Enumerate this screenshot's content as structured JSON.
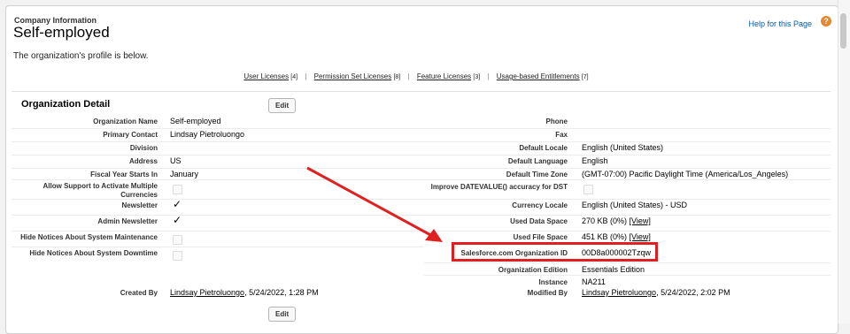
{
  "header": {
    "section_label": "Company Information",
    "title": "Self-employed",
    "help_link": "Help for this Page",
    "help_icon": "?",
    "description": "The organization's profile is below."
  },
  "links": [
    {
      "label": "User Licenses",
      "count": "[4]"
    },
    {
      "label": "Permission Set Licenses",
      "count": "[8]"
    },
    {
      "label": "Feature Licenses",
      "count": "[3]"
    },
    {
      "label": "Usage-based Entitlements",
      "count": "[7]"
    }
  ],
  "link_separator": "|",
  "detail": {
    "heading": "Organization Detail",
    "edit_label": "Edit",
    "left": {
      "org_name_label": "Organization Name",
      "org_name": "Self-employed",
      "primary_contact_label": "Primary Contact",
      "primary_contact": "Lindsay Pietroluongo",
      "division_label": "Division",
      "address_label": "Address",
      "address": "US",
      "fiscal_label": "Fiscal Year Starts In",
      "fiscal": "January",
      "allow_support_label": "Allow Support to Activate Multiple Currencies",
      "newsletter_label": "Newsletter",
      "admin_newsletter_label": "Admin Newsletter",
      "hide_maintenance_label": "Hide Notices About System Maintenance",
      "hide_downtime_label": "Hide Notices About System Downtime",
      "created_by_label": "Created By",
      "created_by_user": "Lindsay Pietroluongo",
      "created_by_date": ", 5/24/2022, 1:28 PM"
    },
    "right": {
      "phone_label": "Phone",
      "fax_label": "Fax",
      "locale_label": "Default Locale",
      "locale": "English (United States)",
      "language_label": "Default Language",
      "language": "English",
      "timezone_label": "Default Time Zone",
      "timezone": "(GMT-07:00) Pacific Daylight Time (America/Los_Angeles)",
      "datevalue_label": "Improve DATEVALUE() accuracy for DST",
      "currency_label": "Currency Locale",
      "currency": "English (United States) - USD",
      "data_space_label": "Used Data Space",
      "data_space": "270 KB (0%) ",
      "file_space_label": "Used File Space",
      "file_space": "451 KB (0%) ",
      "view_link": "[View]",
      "org_id_label": "Salesforce.com Organization ID",
      "org_id": "00D8a000002Tzqw",
      "edition_label": "Organization Edition",
      "edition": "Essentials Edition",
      "instance_label": "Instance",
      "instance": "NA211",
      "modified_by_label": "Modified By",
      "modified_by_user": "Lindsay Pietroluongo",
      "modified_by_date": ", 5/24/2022, 2:02 PM"
    },
    "checkmark": "✓"
  },
  "colors": {
    "highlight": "#e02020",
    "help_icon": "#e8862f",
    "link": "#015ba7"
  }
}
